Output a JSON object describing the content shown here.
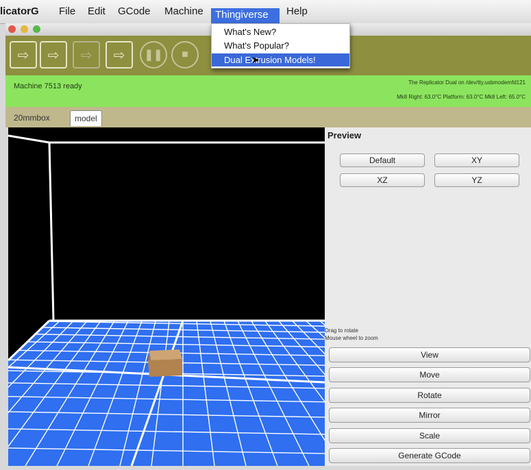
{
  "menubar": {
    "app": "licatorG",
    "items": [
      "File",
      "Edit",
      "GCode",
      "Machine",
      "Thingiverse",
      "Help"
    ]
  },
  "thingiverse_menu": {
    "items": [
      "What's New?",
      "What's Popular?",
      "Dual Extrusion Models!"
    ],
    "selected_index": 2
  },
  "toolbar": {
    "buttons": [
      "build-icon",
      "build-to-file-icon",
      "upload-icon",
      "export-icon",
      "pause-icon",
      "stop-icon"
    ]
  },
  "status": {
    "machine": "Machine 7513 ready",
    "connection": "The Replicator Dual on /dev/tty.usbmodemfd121",
    "temperatures": "Mk8 Right: 63.0°C  Platform: 63.0°C Mk8 Left: 65.0°C"
  },
  "tabs": [
    {
      "label": "20mmbox",
      "active": false
    },
    {
      "label": "model",
      "active": true
    }
  ],
  "preview": {
    "title": "Preview",
    "view_buttons": [
      "Default",
      "XY",
      "XZ",
      "YZ"
    ],
    "hint_rotate": "Drag to rotate",
    "hint_zoom": "Mouse wheel to zoom",
    "action_buttons": [
      "View",
      "Move",
      "Rotate",
      "Mirror",
      "Scale",
      "Generate GCode"
    ]
  },
  "colors": {
    "status_green": "#8ce45e",
    "toolbar_olive": "#8e8f3f",
    "build_plate_blue": "#2f6ff0",
    "menu_highlight": "#3a68d8",
    "model_box": "#b98a5a"
  }
}
